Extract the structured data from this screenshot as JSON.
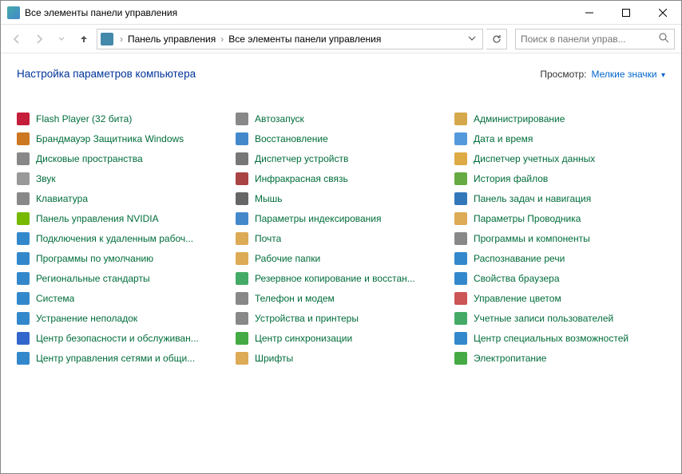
{
  "window": {
    "title": "Все элементы панели управления"
  },
  "toolbar": {
    "breadcrumb": [
      "Панель управления",
      "Все элементы панели управления"
    ],
    "search_placeholder": "Поиск в панели управ..."
  },
  "header": {
    "page_title": "Настройка параметров компьютера",
    "view_label": "Просмотр:",
    "view_value": "Мелкие значки"
  },
  "items": [
    {
      "label": "Flash Player (32 бита)",
      "col": 0,
      "color": "#c41e3a"
    },
    {
      "label": "Автозапуск",
      "col": 1,
      "color": "#888"
    },
    {
      "label": "Администрирование",
      "col": 2,
      "color": "#d4a84b"
    },
    {
      "label": "Брандмауэр Защитника Windows",
      "col": 0,
      "color": "#cc7722"
    },
    {
      "label": "Восстановление",
      "col": 1,
      "color": "#4488cc"
    },
    {
      "label": "Дата и время",
      "col": 2,
      "color": "#5599dd"
    },
    {
      "label": "Дисковые пространства",
      "col": 0,
      "color": "#888"
    },
    {
      "label": "Диспетчер устройств",
      "col": 1,
      "color": "#777"
    },
    {
      "label": "Диспетчер учетных данных",
      "col": 2,
      "color": "#ddaa44"
    },
    {
      "label": "Звук",
      "col": 0,
      "color": "#999"
    },
    {
      "label": "Инфракрасная связь",
      "col": 1,
      "color": "#aa4444"
    },
    {
      "label": "История файлов",
      "col": 2,
      "color": "#66aa44"
    },
    {
      "label": "Клавиатура",
      "col": 0,
      "color": "#888"
    },
    {
      "label": "Мышь",
      "col": 1,
      "color": "#666"
    },
    {
      "label": "Панель задач и навигация",
      "col": 2,
      "color": "#3377bb"
    },
    {
      "label": "Панель управления NVIDIA",
      "col": 0,
      "color": "#76b900"
    },
    {
      "label": "Параметры индексирования",
      "col": 1,
      "color": "#4488cc"
    },
    {
      "label": "Параметры Проводника",
      "col": 2,
      "color": "#ddaa55"
    },
    {
      "label": "Подключения к удаленным рабоч...",
      "col": 0,
      "color": "#3388cc"
    },
    {
      "label": "Почта",
      "col": 1,
      "color": "#ddaa55"
    },
    {
      "label": "Программы и компоненты",
      "col": 2,
      "color": "#888"
    },
    {
      "label": "Программы по умолчанию",
      "col": 0,
      "color": "#3388cc"
    },
    {
      "label": "Рабочие папки",
      "col": 1,
      "color": "#ddaa55"
    },
    {
      "label": "Распознавание речи",
      "col": 2,
      "color": "#3388cc"
    },
    {
      "label": "Региональные стандарты",
      "col": 0,
      "color": "#3388cc"
    },
    {
      "label": "Резервное копирование и восстан...",
      "col": 1,
      "color": "#44aa66"
    },
    {
      "label": "Свойства браузера",
      "col": 2,
      "color": "#3388cc"
    },
    {
      "label": "Система",
      "col": 0,
      "color": "#3388cc"
    },
    {
      "label": "Телефон и модем",
      "col": 1,
      "color": "#888"
    },
    {
      "label": "Управление цветом",
      "col": 2,
      "color": "#cc5555"
    },
    {
      "label": "Устранение неполадок",
      "col": 0,
      "color": "#3388cc"
    },
    {
      "label": "Устройства и принтеры",
      "col": 1,
      "color": "#888"
    },
    {
      "label": "Учетные записи пользователей",
      "col": 2,
      "color": "#44aa66"
    },
    {
      "label": "Центр безопасности и обслуживан...",
      "col": 0,
      "color": "#3366cc"
    },
    {
      "label": "Центр синхронизации",
      "col": 1,
      "color": "#44aa44"
    },
    {
      "label": "Центр специальных возможностей",
      "col": 2,
      "color": "#3388cc"
    },
    {
      "label": "Центр управления сетями и общи...",
      "col": 0,
      "color": "#3388cc"
    },
    {
      "label": "Шрифты",
      "col": 1,
      "color": "#ddaa55"
    },
    {
      "label": "Электропитание",
      "col": 2,
      "color": "#44aa44"
    }
  ]
}
